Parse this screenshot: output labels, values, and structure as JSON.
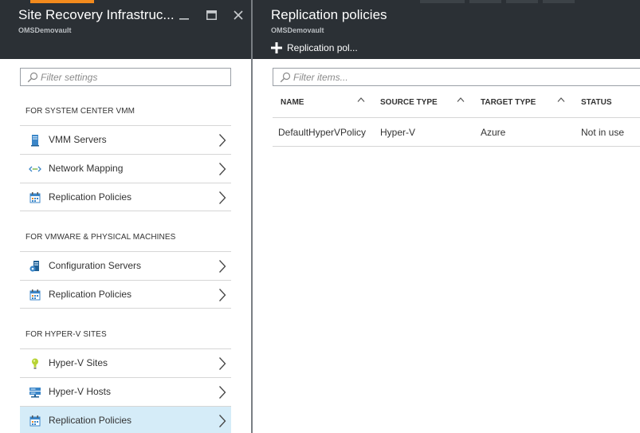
{
  "left_blade": {
    "title": "Site Recovery Infrastruc...",
    "subtitle": "OMSDemovault",
    "window_controls": [
      "minimize",
      "maximize",
      "close"
    ],
    "filter_placeholder": "Filter settings",
    "sections": [
      {
        "title": "FOR SYSTEM CENTER VMM",
        "items": [
          {
            "label": "VMM Servers",
            "icon": "server-icon"
          },
          {
            "label": "Network Mapping",
            "icon": "network-mapping-icon"
          },
          {
            "label": "Replication Policies",
            "icon": "calendar-policy-icon"
          }
        ]
      },
      {
        "title": "FOR VMWARE & PHYSICAL MACHINES",
        "items": [
          {
            "label": "Configuration Servers",
            "icon": "configuration-server-icon"
          },
          {
            "label": "Replication Policies",
            "icon": "calendar-policy-icon"
          }
        ]
      },
      {
        "title": "FOR HYPER-V SITES",
        "items": [
          {
            "label": "Hyper-V Sites",
            "icon": "lightbulb-icon"
          },
          {
            "label": "Hyper-V Hosts",
            "icon": "host-icon"
          },
          {
            "label": "Replication Policies",
            "icon": "calendar-policy-icon",
            "selected": true
          }
        ]
      }
    ]
  },
  "right_blade": {
    "title": "Replication policies",
    "subtitle": "OMSDemovault",
    "add_command": "Replication pol...",
    "filter_placeholder": "Filter items...",
    "columns": [
      "NAME",
      "SOURCE TYPE",
      "TARGET TYPE",
      "STATUS"
    ],
    "rows": [
      [
        "DefaultHyperVPolicy",
        "Hyper-V",
        "Azure",
        "Not in use"
      ]
    ]
  },
  "colors": {
    "header_bg": "#2b3035",
    "accent": "#f28a1d",
    "selected_bg": "#d5ecf8"
  }
}
